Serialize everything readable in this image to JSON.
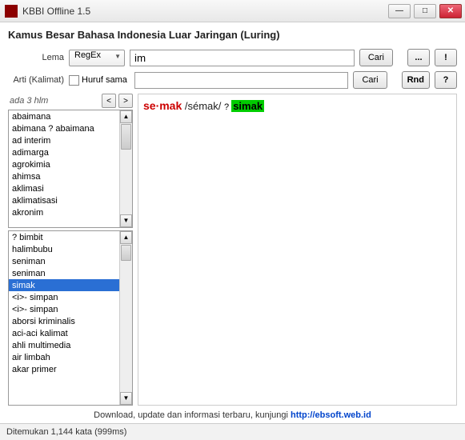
{
  "window": {
    "title": "KBBI Offline 1.5"
  },
  "heading": "Kamus Besar Bahasa Indonesia Luar Jaringan (Luring)",
  "search": {
    "lema_label": "Lema",
    "mode": "RegEx",
    "query": "im",
    "cari": "Cari",
    "arti_label": "Arti (Kalimat)",
    "huruf_sama": "Huruf sama",
    "arti_query": "",
    "btn_dots": "...",
    "btn_bang": "!",
    "btn_rnd": "Rnd",
    "btn_q": "?"
  },
  "pager": {
    "info": "ada 3 hlm",
    "prev": "<",
    "next": ">"
  },
  "list1": [
    "abaimana",
    "abimana ? abaimana",
    "ad interim",
    "adimarga",
    "agrokimia",
    "ahimsa",
    "aklimasi",
    "aklimatisasi",
    "akronim"
  ],
  "list2": {
    "items": [
      "? bimbit",
      "halimbubu",
      "seniman",
      "seniman",
      "simak",
      "<i>- simpan",
      "<i>- simpan",
      "aborsi kriminalis",
      "aci-aci kalimat",
      "ahli multimedia",
      "air limbah",
      "akar primer"
    ],
    "selected": 4
  },
  "definition": {
    "headword": "se·mak",
    "pron": " /sémak/ ",
    "arrow": "?",
    "ref": "simak"
  },
  "footer": {
    "text_before": "Download, update dan informasi terbaru, kunjungi ",
    "link": "http://ebsoft.web.id"
  },
  "status": "Ditemukan 1,144 kata (999ms)"
}
